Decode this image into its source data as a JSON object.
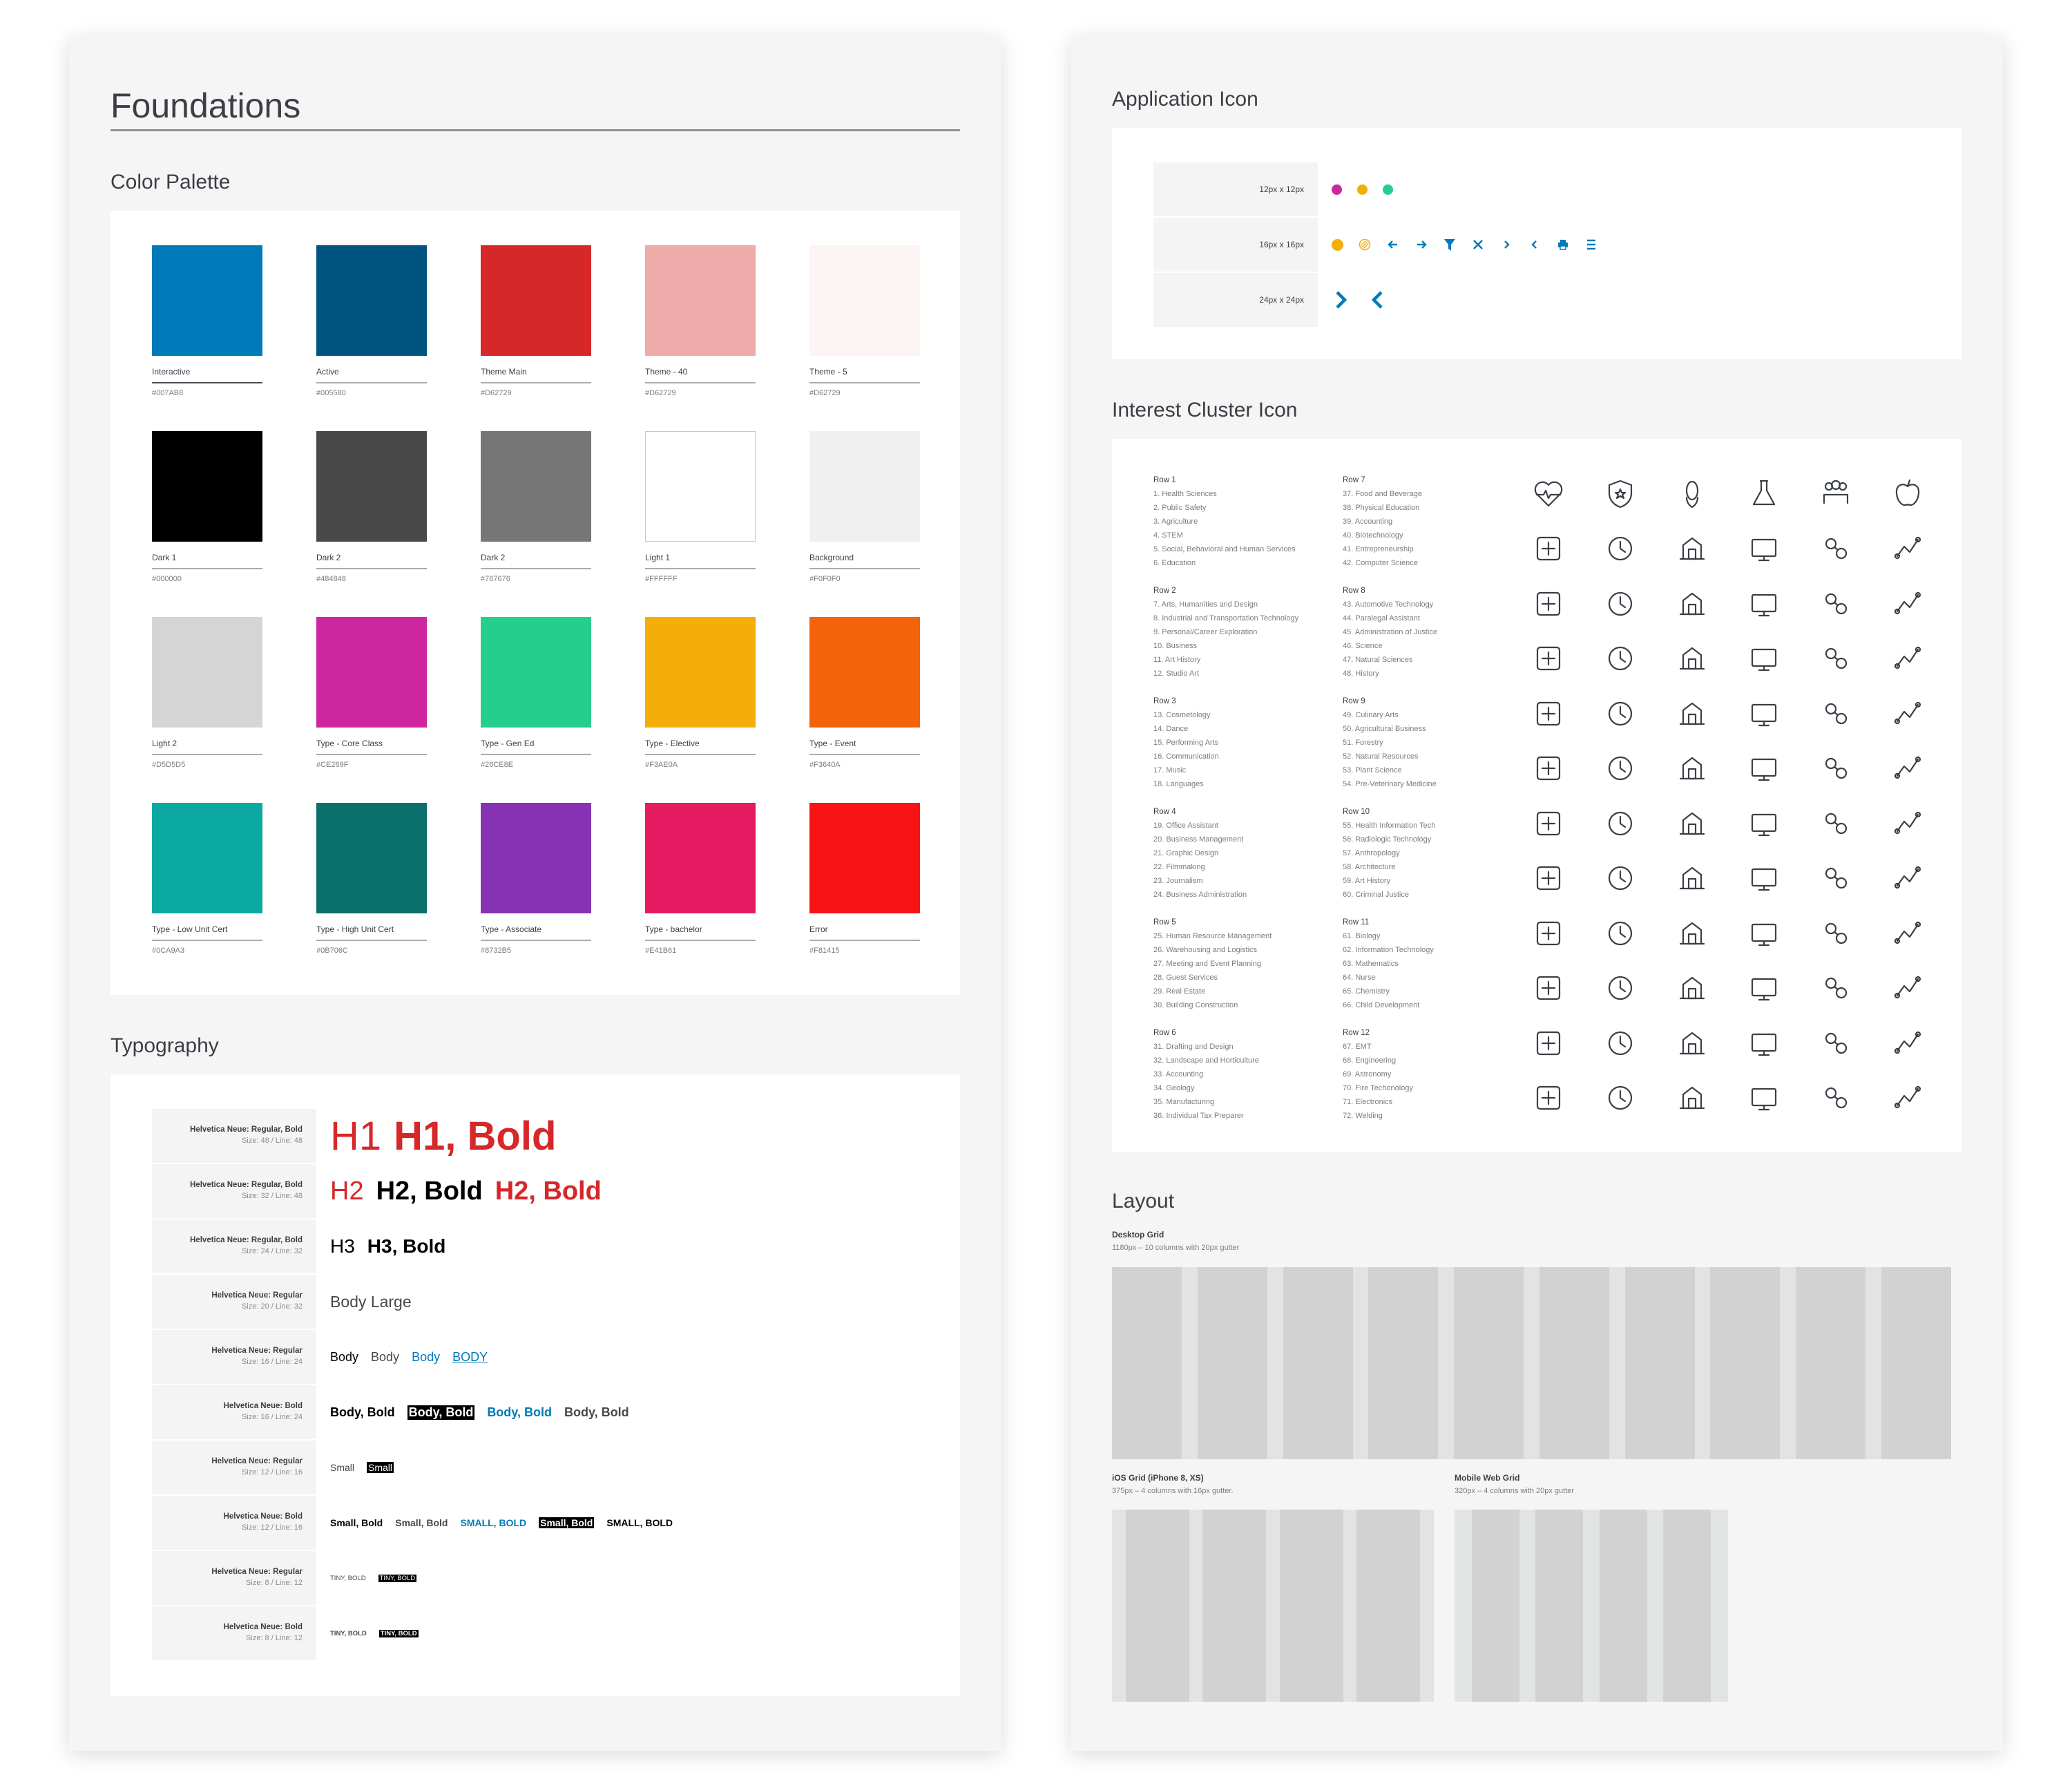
{
  "foundations": {
    "title": "Foundations",
    "color_palette": {
      "title": "Color Palette",
      "swatches": [
        {
          "name": "Interactive",
          "hex": "#007AB8",
          "color": "#007AB8"
        },
        {
          "name": "Active",
          "hex": "#005580",
          "color": "#005580"
        },
        {
          "name": "Theme Main",
          "hex": "#D62729",
          "color": "#D62729"
        },
        {
          "name": "Theme - 40",
          "hex": "#D62729",
          "color": "#EFAAAA"
        },
        {
          "name": "Theme - 5",
          "hex": "#D62729",
          "color": "#FDF4F4"
        },
        {
          "name": "Dark 1",
          "hex": "#000000",
          "color": "#000000"
        },
        {
          "name": "Dark 2",
          "hex": "#484848",
          "color": "#484848"
        },
        {
          "name": "Dark 2",
          "hex": "#767676",
          "color": "#767676"
        },
        {
          "name": "Light 1",
          "hex": "#FFFFFF",
          "color": "#FFFFFF"
        },
        {
          "name": "Background",
          "hex": "#F0F0F0",
          "color": "#F0F0F0"
        },
        {
          "name": "Light 2",
          "hex": "#D5D5D5",
          "color": "#D5D5D5"
        },
        {
          "name": "Type - Core Class",
          "hex": "#CE269F",
          "color": "#CE269F"
        },
        {
          "name": "Type - Gen Ed",
          "hex": "#26CE8E",
          "color": "#26CE8E"
        },
        {
          "name": "Type - Elective",
          "hex": "#F3AE0A",
          "color": "#F3AE0A"
        },
        {
          "name": "Type - Event",
          "hex": "#F3640A",
          "color": "#F3640A"
        },
        {
          "name": "Type - Low Unit Cert",
          "hex": "#0CA9A3",
          "color": "#0CA9A3"
        },
        {
          "name": "Type - High Unit Cert",
          "hex": "#0B706C",
          "color": "#0B706C"
        },
        {
          "name": "Type - Associate",
          "hex": "#8732B5",
          "color": "#8732B5"
        },
        {
          "name": "Type - bachelor",
          "hex": "#E41B61",
          "color": "#E41B61"
        },
        {
          "name": "Error",
          "hex": "#F81415",
          "color": "#F81415"
        }
      ]
    },
    "typography": {
      "title": "Typography",
      "rows": [
        {
          "font": "Helvetica Neue: Regular, Bold",
          "size": "Size: 48 / Line: 48",
          "samples": [
            "H1",
            "H1, Bold"
          ]
        },
        {
          "font": "Helvetica Neue: Regular, Bold",
          "size": "Size: 32 / Line: 48",
          "samples": [
            "H2",
            "H2, Bold",
            "H2, Bold"
          ]
        },
        {
          "font": "Helvetica Neue: Regular, Bold",
          "size": "Size: 24 / Line: 32",
          "samples": [
            "H3",
            "H3, Bold"
          ]
        },
        {
          "font": "Helvetica Neue: Regular",
          "size": "Size: 20 / Line: 32",
          "samples": [
            "Body Large"
          ]
        },
        {
          "font": "Helvetica Neue: Regular",
          "size": "Size: 16 / Line: 24",
          "samples": [
            "Body",
            "Body",
            "Body",
            "BODY"
          ]
        },
        {
          "font": "Helvetica Neue: Bold",
          "size": "Size: 16 / Line: 24",
          "samples": [
            "Body, Bold",
            "Body, Bold",
            "Body, Bold",
            "Body, Bold"
          ]
        },
        {
          "font": "Helvetica Neue: Regular",
          "size": "Size: 12 / Line: 16",
          "samples": [
            "Small",
            "Small"
          ]
        },
        {
          "font": "Helvetica Neue: Bold",
          "size": "Size: 12 / Line: 16",
          "samples": [
            "Small, Bold",
            "Small, Bold",
            "SMALL, BOLD",
            "Small, Bold",
            "SMALL, BOLD"
          ]
        },
        {
          "font": "Helvetica Neue: Regular",
          "size": "Size: 8 / Line: 12",
          "samples": [
            "TINY, BOLD",
            "TINY, BOLD"
          ]
        },
        {
          "font": "Helvetica Neue: Bold",
          "size": "Size: 8 / Line: 12",
          "samples": [
            "TINY, BOLD",
            "TINY, BOLD"
          ]
        }
      ]
    }
  },
  "application_icon": {
    "title": "Application Icon",
    "rows": [
      {
        "label": "12px x 12px",
        "icons": [
          "dot-core-class-icon",
          "dot-elective-icon",
          "dot-gen-ed-icon"
        ]
      },
      {
        "label": "16px x 16px",
        "icons": [
          "dot-elective-icon",
          "hatched-circle-icon",
          "arrow-left-icon",
          "arrow-right-icon",
          "filter-icon",
          "close-icon",
          "chevron-right-icon",
          "chevron-left-icon",
          "print-icon",
          "menu-icon"
        ]
      },
      {
        "label": "24px x 24px",
        "icons": [
          "chevron-right-large-icon",
          "chevron-left-large-icon"
        ]
      }
    ],
    "colors": {
      "magenta": "#CE269F",
      "amber": "#F3AE0A",
      "green": "#26CE8E",
      "blue": "#007AB8"
    }
  },
  "interest_cluster": {
    "title": "Interest Cluster Icon",
    "groups": [
      {
        "row": "Row 1",
        "items": [
          "1. Health Sciences",
          "2. Public Safety",
          "3. Agriculture",
          "4. STEM",
          "5. Social, Behavioral and Human Services",
          "6. Education"
        ]
      },
      {
        "row": "Row 2",
        "items": [
          "7. Arts, Humanities and Design",
          "8. Industrial and Transportation Technology",
          "9. Personal/Career Exploration",
          "10. Business",
          "11. Art History",
          "12. Studio Art"
        ]
      },
      {
        "row": "Row 3",
        "items": [
          "13. Cosmetology",
          "14. Dance",
          "15. Performing Arts",
          "16. Communication",
          "17. Music",
          "18. Languages"
        ]
      },
      {
        "row": "Row 4",
        "items": [
          "19. Office Assistant",
          "20. Business Management",
          "21. Graphic Design",
          "22. Filmmaking",
          "23. Journalism",
          "24. Business Administration"
        ]
      },
      {
        "row": "Row 5",
        "items": [
          "25. Human Resource Management",
          "26. Warehousing and Logistics",
          "27. Meeting and Event Planning",
          "28. Guest Services",
          "29. Real Estate",
          "30. Building Construction"
        ]
      },
      {
        "row": "Row 6",
        "items": [
          "31. Drafting and Design",
          "32. Landscape and Horticulture",
          "33. Accounting",
          "34. Geology",
          "35. Manufacturing",
          "36. Individual Tax Preparer"
        ]
      },
      {
        "row": "Row 7",
        "items": [
          "37. Food and Beverage",
          "38. Physical Education",
          "39. Accounting",
          "40. Biotechnology",
          "41. Entrepreneurship",
          "42. Computer Science"
        ]
      },
      {
        "row": "Row 8",
        "items": [
          "43. Automotive Technology",
          "44. Paralegal Assistant",
          "45. Administration of Justice",
          "46. Science",
          "47. Natural Sciences",
          "48. History"
        ]
      },
      {
        "row": "Row 9",
        "items": [
          "49. Culinary Arts",
          "50. Agricultural Business",
          "51. Forestry",
          "52. Natural Resources",
          "53. Plant Science",
          "54. Pre-Veterinary Medicine"
        ]
      },
      {
        "row": "Row 10",
        "items": [
          "55. Health Information Tech",
          "56. Radiologic Technology",
          "57. Anthropology",
          "58. Architecture",
          "59. Art History",
          "60. Criminal Justice"
        ]
      },
      {
        "row": "Row 11",
        "items": [
          "61. Biology",
          "62. Information Technology",
          "63. Mathematics",
          "64. Nurse",
          "65. Chemistry",
          "66. Child Development"
        ]
      },
      {
        "row": "Row 12",
        "items": [
          "67. EMT",
          "68. Engineering",
          "69. Astronomy",
          "70. Fire Techonology",
          "71. Electronics",
          "72. Welding"
        ]
      }
    ],
    "icons": [
      "heart-pulse-icon",
      "shield-star-icon",
      "corn-icon",
      "flask-icon",
      "people-group-icon",
      "apple-icon",
      "easel-icon",
      "robot-arm-icon",
      "binoculars-icon",
      "chart-growth-icon",
      "column-icon",
      "paintbrush-icon",
      "hair-dryer-icon",
      "dancer-icon",
      "theater-masks-icon",
      "chat-bubble-icon",
      "music-notes-icon",
      "globe-chat-icon",
      "headset-person-icon",
      "shop-gear-icon",
      "pen-tool-icon",
      "video-camera-icon",
      "recorder-icon",
      "org-chart-icon",
      "hr-swap-icon",
      "forklift-icon",
      "calendar-icon",
      "service-bell-icon",
      "house-icon",
      "excavator-icon",
      "compass-drafting-icon",
      "trees-icon",
      "calculator-icon",
      "rocks-icon",
      "factory-icon",
      "calculator-money-icon",
      "plate-utensils-icon",
      "seeds-icon",
      "clipboard-chart-icon",
      "nodes-graph-icon",
      "lightbulb-icon",
      "laptop-icon",
      "connected-car-icon",
      "scales-icon",
      "gavel-icon",
      "atom-icon",
      "plant-dna-icon",
      "open-book-icon",
      "chef-hat-icon",
      "hand-sprout-icon",
      "pine-trees-icon",
      "sprout-plug-icon",
      "sprout-flask-icon",
      "paw-plus-icon",
      "medical-monitor-icon",
      "xray-icon",
      "skull-books-icon",
      "city-buildings-icon",
      "aqueduct-icon",
      "handcuffs-icon",
      "honeycomb-icon",
      "monitor-icon",
      "math-calculator-icon",
      "nurse-icon",
      "chemistry-icon",
      "baby-icon",
      "ambulance-icon",
      "hard-hat-worker-icon",
      "telescope-icon",
      "fire-extinguisher-flame-icon",
      "circuit-icon",
      "welding-mask-icon"
    ]
  },
  "layout": {
    "title": "Layout",
    "desktop": {
      "label": "Desktop Grid",
      "desc": "1180px – 10 columns with 20px gutter",
      "columns": 10
    },
    "ios": {
      "label": "iOS Grid (iPhone 8, XS)",
      "desc": "375px – 4 columns with 16px gutter.",
      "columns": 4
    },
    "mobile_web": {
      "label": "Mobile Web Grid",
      "desc": "320px – 4 columns with 20px gutter",
      "columns": 4
    }
  }
}
